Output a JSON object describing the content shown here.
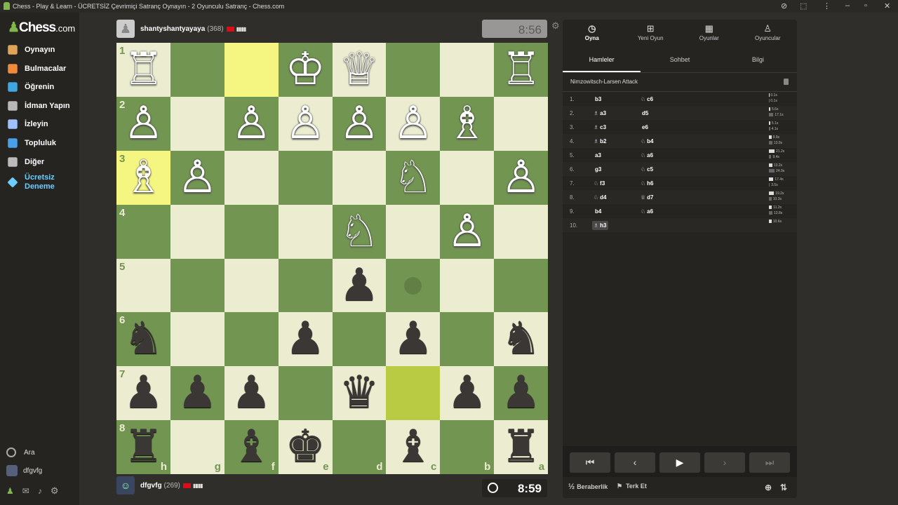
{
  "window": {
    "title": "Chess - Play & Learn - ÜCRETSİZ Çevrimiçi Satranç Oynayın - 2 Oyunculu Satranç - Chess.com"
  },
  "sidebar": {
    "logo_main": "Chess",
    "logo_suffix": ".com",
    "items": [
      {
        "label": "Oynayın",
        "icon": "board-hand-icon",
        "color": "#e0a458"
      },
      {
        "label": "Bulmacalar",
        "icon": "puzzle-icon",
        "color": "#f08a3c"
      },
      {
        "label": "Öğrenin",
        "icon": "graduation-cap-icon",
        "color": "#3fa7e0"
      },
      {
        "label": "İdman Yapın",
        "icon": "dumbbell-icon",
        "color": "#b8b8b8"
      },
      {
        "label": "İzleyin",
        "icon": "binoculars-icon",
        "color": "#9fc0ff"
      },
      {
        "label": "Topluluk",
        "icon": "community-icon",
        "color": "#4aa0e8"
      },
      {
        "label": "Diğer",
        "icon": "more-dots-icon",
        "color": "#bbbbbb"
      }
    ],
    "premium": {
      "line1": "Ücretsiz",
      "line2": "Deneme"
    },
    "search_label": "Ara",
    "username": "dfgvfg"
  },
  "top_player": {
    "name": "shantyshantyayaya",
    "rating": "(368)",
    "clock": "8:56"
  },
  "bottom_player": {
    "name": "dfgvfg",
    "rating": "(269)",
    "clock": "8:59"
  },
  "board": {
    "ranks": [
      "1",
      "2",
      "3",
      "4",
      "5",
      "6",
      "7",
      "8"
    ],
    "files": [
      "h",
      "g",
      "f",
      "e",
      "d",
      "c",
      "b",
      "a"
    ],
    "pieces": [
      [
        "wR",
        "",
        "",
        "wK",
        "wQ",
        "",
        "",
        "wR"
      ],
      [
        "wP",
        "",
        "wP",
        "wP",
        "wP",
        "wP",
        "wB",
        ""
      ],
      [
        "wB",
        "wP",
        "",
        "",
        "",
        "wN",
        "",
        "wP"
      ],
      [
        "",
        "",
        "",
        "",
        "wN",
        "",
        "wP",
        ""
      ],
      [
        "",
        "",
        "",
        "",
        "bP",
        "",
        "",
        ""
      ],
      [
        "bN",
        "",
        "",
        "bP",
        "",
        "bP",
        "",
        "bN"
      ],
      [
        "bP",
        "bP",
        "bP",
        "",
        "bQ",
        "",
        "bP",
        "bP"
      ],
      [
        "bR",
        "",
        "bB",
        "bK",
        "",
        "bB",
        "",
        "bR"
      ]
    ],
    "highlight_squares": [
      "row1col3",
      "row3col1",
      "row7col6"
    ],
    "move_hint": "row5col6"
  },
  "panel": {
    "tabs": [
      {
        "label": "Oyna",
        "icon": "stopwatch-icon"
      },
      {
        "label": "Yeni Oyun",
        "icon": "plus-icon"
      },
      {
        "label": "Oyunlar",
        "icon": "board-icon"
      },
      {
        "label": "Oyuncular",
        "icon": "players-icon"
      }
    ],
    "subtabs": [
      "Hamleler",
      "Sohbet",
      "Bilgi"
    ],
    "opening": "Nimzowitsch-Larsen Attack",
    "moves": [
      {
        "num": "1.",
        "white": "b3",
        "white_fig": "",
        "black": "c6",
        "black_fig": "♘",
        "tw": "0.1s",
        "tb": "0.1s",
        "fw": 0.05,
        "fb": 0.05
      },
      {
        "num": "2.",
        "white": "a3",
        "white_fig": "♗",
        "black": "d5",
        "black_fig": "",
        "tw": "5.6s",
        "tb": "17.1s",
        "fw": 0.25,
        "fb": 0.8
      },
      {
        "num": "3.",
        "white": "c3",
        "white_fig": "♗",
        "black": "e6",
        "black_fig": "",
        "tw": "5.1s",
        "tb": "4.1s",
        "fw": 0.24,
        "fb": 0.2
      },
      {
        "num": "4.",
        "white": "b2",
        "white_fig": "♗",
        "black": "b4",
        "black_fig": "♘",
        "tw": "9.9s",
        "tb": "13.0s",
        "fw": 0.45,
        "fb": 0.6
      },
      {
        "num": "5.",
        "white": "a3",
        "white_fig": "",
        "black": "a6",
        "black_fig": "♘",
        "tw": "21.2s",
        "tb": "9.4s",
        "fw": 1.0,
        "fb": 0.43
      },
      {
        "num": "6.",
        "white": "g3",
        "white_fig": "",
        "black": "c5",
        "black_fig": "♘",
        "tw": "13.2s",
        "tb": "24.9s",
        "fw": 0.6,
        "fb": 1.0
      },
      {
        "num": "7.",
        "white": "f3",
        "white_fig": "♘",
        "black": "h6",
        "black_fig": "♘",
        "tw": "17.4s",
        "tb": "3.5s",
        "fw": 0.8,
        "fb": 0.16
      },
      {
        "num": "8.",
        "white": "d4",
        "white_fig": "♘",
        "black": "d7",
        "black_fig": "♕",
        "tw": "19.2s",
        "tb": "10.3s",
        "fw": 0.9,
        "fb": 0.47
      },
      {
        "num": "9.",
        "white": "b4",
        "white_fig": "",
        "black": "a6",
        "black_fig": "♘",
        "tw": "11.2s",
        "tb": "13.8s",
        "fw": 0.52,
        "fb": 0.63
      },
      {
        "num": "10.",
        "white": "h3",
        "white_fig": "♗",
        "black": "",
        "black_fig": "",
        "tw": "10.6s",
        "tb": "",
        "fw": 0.48,
        "fb": 0
      }
    ],
    "controls": [
      {
        "glyph": "⏮",
        "icon": "first-move-icon"
      },
      {
        "glyph": "‹",
        "icon": "prev-move-icon"
      },
      {
        "glyph": "▶",
        "icon": "play-icon"
      },
      {
        "glyph": "›",
        "icon": "next-move-icon"
      },
      {
        "glyph": "⏭",
        "icon": "last-move-icon"
      }
    ],
    "draw_label": "Beraberlik",
    "draw_prefix": "½",
    "resign_label": "Terk Et"
  }
}
